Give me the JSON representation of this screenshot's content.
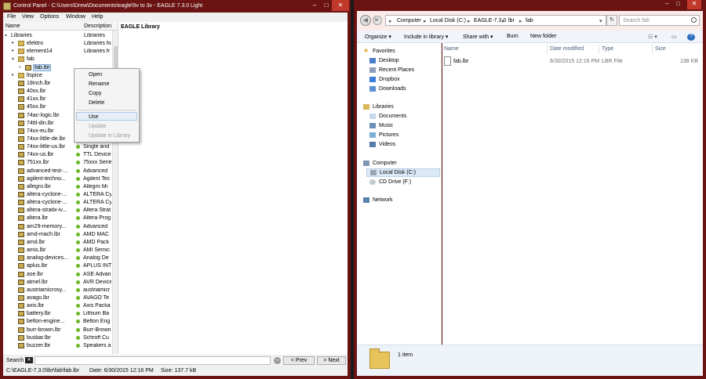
{
  "eagle": {
    "title": "Control Panel - C:\\Users\\Drew\\Documents\\eagle\\5v to 3v - EAGLE 7.3.0 Light",
    "menu": [
      "File",
      "View",
      "Options",
      "Window",
      "Help"
    ],
    "tree_header": {
      "name": "Name",
      "description": "Description"
    },
    "tree": [
      {
        "arrow": "▴",
        "level": 0,
        "icon": "none",
        "name": "Libraries",
        "desc": "Libraries"
      },
      {
        "arrow": "▸",
        "level": 1,
        "icon": "folder",
        "name": "elektro",
        "desc": "Libraries fo"
      },
      {
        "arrow": "▸",
        "level": 1,
        "icon": "folder",
        "name": "element14",
        "desc": "Libraries fr"
      },
      {
        "arrow": "▴",
        "level": 1,
        "icon": "folder",
        "name": "fab",
        "desc": ""
      },
      {
        "arrow": "▹",
        "level": 2,
        "icon": "lbr",
        "name": "fab.lbr",
        "desc": "",
        "selected": true
      },
      {
        "arrow": "▸",
        "level": 1,
        "icon": "folder",
        "name": "ltspice",
        "desc": ""
      },
      {
        "arrow": "",
        "level": 1,
        "icon": "lbr",
        "name": "19inch.lbr",
        "desc": ""
      },
      {
        "arrow": "",
        "level": 1,
        "icon": "lbr",
        "name": "40xx.lbr",
        "desc": ""
      },
      {
        "arrow": "",
        "level": 1,
        "icon": "lbr",
        "name": "41xx.lbr",
        "desc": ""
      },
      {
        "arrow": "",
        "level": 1,
        "icon": "lbr",
        "name": "45xx.lbr",
        "desc": ""
      },
      {
        "arrow": "",
        "level": 1,
        "icon": "lbr",
        "name": "74ac-logic.lbr",
        "desc": ""
      },
      {
        "arrow": "",
        "level": 1,
        "icon": "lbr",
        "name": "74ttl-din.lbr",
        "desc": ""
      },
      {
        "arrow": "",
        "level": 1,
        "icon": "lbr",
        "name": "74xx-eu.lbr",
        "desc": ""
      },
      {
        "arrow": "",
        "level": 1,
        "icon": "lbr",
        "name": "74xx-little-de.lbr",
        "desc": ""
      },
      {
        "arrow": "",
        "level": 1,
        "icon": "lbr",
        "name": "74xx-little-us.lbr",
        "desc": "Single and",
        "dot": true
      },
      {
        "arrow": "",
        "level": 1,
        "icon": "lbr",
        "name": "74xx-us.lbr",
        "desc": "TTL Device",
        "dot": true
      },
      {
        "arrow": "",
        "level": 1,
        "icon": "lbr",
        "name": "751xx.lbr",
        "desc": "75xxx Serie",
        "dot": true
      },
      {
        "arrow": "",
        "level": 1,
        "icon": "lbr",
        "name": "advanced-test-...",
        "desc": "Advanced",
        "dot": true
      },
      {
        "arrow": "",
        "level": 1,
        "icon": "lbr",
        "name": "agilent-techno...",
        "desc": "Agilent Tec",
        "dot": true
      },
      {
        "arrow": "",
        "level": 1,
        "icon": "lbr",
        "name": "allegro.lbr",
        "desc": "Allegro Mi",
        "dot": true
      },
      {
        "arrow": "",
        "level": 1,
        "icon": "lbr",
        "name": "altera-cyclone-...",
        "desc": "ALTERA Cy",
        "dot": true
      },
      {
        "arrow": "",
        "level": 1,
        "icon": "lbr",
        "name": "altera-cyclone-...",
        "desc": "ALTERA Cy",
        "dot": true
      },
      {
        "arrow": "",
        "level": 1,
        "icon": "lbr",
        "name": "altera-stratix-iv...",
        "desc": "Altera Strat",
        "dot": true
      },
      {
        "arrow": "",
        "level": 1,
        "icon": "lbr",
        "name": "altera.lbr",
        "desc": "Altera Prog",
        "dot": true
      },
      {
        "arrow": "",
        "level": 1,
        "icon": "lbr",
        "name": "am29-memory...",
        "desc": "Advanced",
        "dot": true
      },
      {
        "arrow": "",
        "level": 1,
        "icon": "lbr",
        "name": "amd-mach.lbr",
        "desc": "AMD MAC",
        "dot": true
      },
      {
        "arrow": "",
        "level": 1,
        "icon": "lbr",
        "name": "amd.lbr",
        "desc": "AMD Pack",
        "dot": true
      },
      {
        "arrow": "",
        "level": 1,
        "icon": "lbr",
        "name": "amis.lbr",
        "desc": "AMI Semic",
        "dot": true
      },
      {
        "arrow": "",
        "level": 1,
        "icon": "lbr",
        "name": "analog-devices...",
        "desc": "Analog De",
        "dot": true
      },
      {
        "arrow": "",
        "level": 1,
        "icon": "lbr",
        "name": "aplus.lbr",
        "desc": "APLUS INT",
        "dot": true
      },
      {
        "arrow": "",
        "level": 1,
        "icon": "lbr",
        "name": "ase.lbr",
        "desc": "ASE Advan",
        "dot": true
      },
      {
        "arrow": "",
        "level": 1,
        "icon": "lbr",
        "name": "atmel.lbr",
        "desc": "AVR Device",
        "dot": true
      },
      {
        "arrow": "",
        "level": 1,
        "icon": "lbr",
        "name": "austriamicrosy...",
        "desc": "austriamicr",
        "dot": true
      },
      {
        "arrow": "",
        "level": 1,
        "icon": "lbr",
        "name": "avago.lbr",
        "desc": "AVAGO Te",
        "dot": true
      },
      {
        "arrow": "",
        "level": 1,
        "icon": "lbr",
        "name": "axis.lbr",
        "desc": "Axis Packa",
        "dot": true
      },
      {
        "arrow": "",
        "level": 1,
        "icon": "lbr",
        "name": "battery.lbr",
        "desc": "Lithium Ba",
        "dot": true
      },
      {
        "arrow": "",
        "level": 1,
        "icon": "lbr",
        "name": "belton-engine...",
        "desc": "Belton Eng",
        "dot": true
      },
      {
        "arrow": "",
        "level": 1,
        "icon": "lbr",
        "name": "burr-brown.lbr",
        "desc": "Burr-Brown",
        "dot": true
      },
      {
        "arrow": "",
        "level": 1,
        "icon": "lbr",
        "name": "busbar.lbr",
        "desc": "Schroff Cu",
        "dot": true
      },
      {
        "arrow": "",
        "level": 1,
        "icon": "lbr",
        "name": "buzzer.lbr",
        "desc": "Speakers a",
        "dot": true
      }
    ],
    "context_menu": [
      {
        "label": "Open",
        "disabled": false
      },
      {
        "label": "Rename",
        "disabled": false
      },
      {
        "label": "Copy",
        "disabled": false
      },
      {
        "label": "Delete",
        "disabled": false
      },
      {
        "label": "Use",
        "disabled": false,
        "highlighted": true
      },
      {
        "label": "Update",
        "disabled": true
      },
      {
        "label": "Update in Library",
        "disabled": true
      }
    ],
    "detail_title": "EAGLE Library",
    "search": {
      "label": "Search",
      "clear_icon": "clear-icon",
      "value": "",
      "prev": "< Prev",
      "next": "> Next"
    },
    "status": {
      "path": "C:\\EAGLE-7.3.0\\lbr\\fab\\fab.lbr",
      "date": "Date: 6/30/2015 12:16 PM",
      "size": "Size: 137.7 kB"
    }
  },
  "explorer": {
    "address": [
      "Computer",
      "Local Disk (C:)",
      "EAGLE-7.3.0",
      "lbr",
      "fab"
    ],
    "search_placeholder": "Search fab",
    "commands": [
      "Organize ▾",
      "Include in library ▾",
      "Share with ▾",
      "Burn",
      "New folder"
    ],
    "nav": {
      "favorites": {
        "title": "Favorites",
        "items": [
          "Desktop",
          "Recent Places",
          "Dropbox",
          "Downloads"
        ]
      },
      "libraries": {
        "title": "Libraries",
        "items": [
          "Documents",
          "Music",
          "Pictures",
          "Videos"
        ]
      },
      "computer": {
        "title": "Computer",
        "items": [
          "Local Disk (C:)",
          "CD Drive (F:)"
        ]
      },
      "network": {
        "title": "Network"
      }
    },
    "columns": [
      "Name",
      "Date modified",
      "Type",
      "Size"
    ],
    "files": [
      {
        "name": "fab.lbr",
        "date": "6/30/2015 12:16 PM",
        "type": "LBR File",
        "size": "138 KB"
      }
    ],
    "item_count": "1 item"
  },
  "colors": {
    "window_frame": "#6b1313",
    "selection": "#cfe3f7",
    "dot_green": "#6ab82a"
  }
}
